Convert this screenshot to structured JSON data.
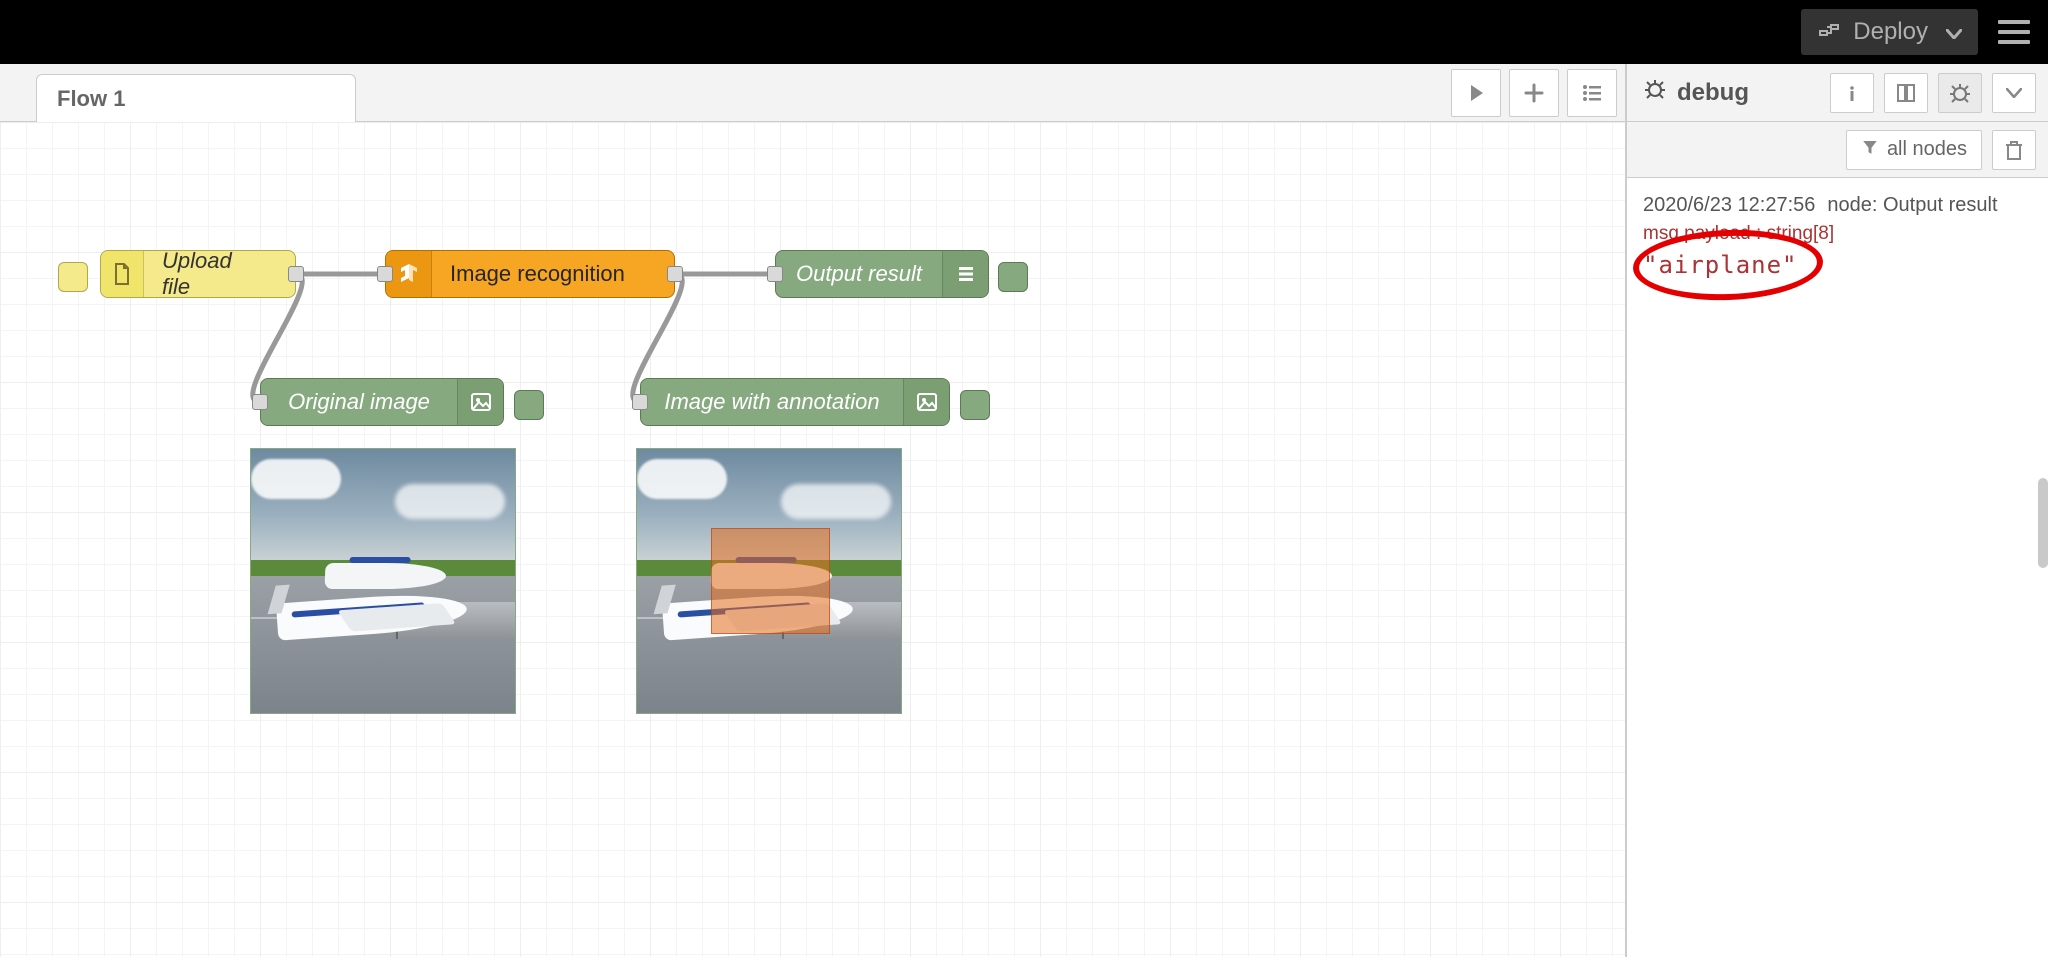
{
  "header": {
    "deploy_label": "Deploy"
  },
  "tabs": {
    "active": "Flow 1"
  },
  "nodes": {
    "upload": {
      "label": "Upload file"
    },
    "recognize": {
      "label": "Image recognition"
    },
    "output": {
      "label": "Output result"
    },
    "original": {
      "label": "Original image"
    },
    "annotated": {
      "label": "Image with annotation"
    }
  },
  "sidebar": {
    "title": "debug",
    "filter_label": "all nodes"
  },
  "debug": {
    "timestamp": "2020/6/23 12:27:56",
    "source_label": "node: Output result",
    "type_line": "msg.payload : string[8]",
    "value": "\"airplane\""
  }
}
